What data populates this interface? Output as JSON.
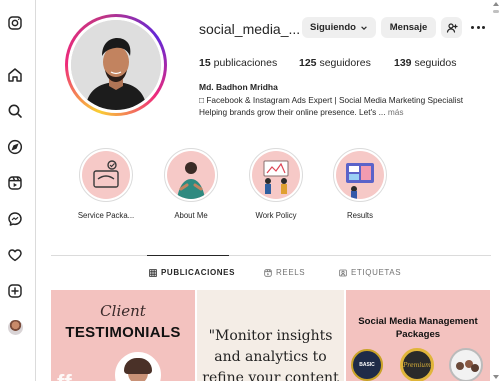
{
  "profile": {
    "username": "social_media_...",
    "following_label": "Siguiendo",
    "message_label": "Mensaje",
    "stats": {
      "posts_count": "15",
      "posts_label": "publicaciones",
      "followers_count": "125",
      "followers_label": "seguidores",
      "following_count": "139",
      "following_label": "seguidos"
    },
    "full_name": "Md. Badhon Mridha",
    "bio_line1": "□ Facebook & Instagram Ads Expert | Social Media Marketing Specialist",
    "bio_line2": "Helping brands grow their online presence. Let's ...",
    "bio_more": "más"
  },
  "highlights": [
    {
      "label": "Service Packa..."
    },
    {
      "label": "About Me"
    },
    {
      "label": "Work Policy"
    },
    {
      "label": "Results"
    }
  ],
  "tabs": [
    {
      "label": "PUBLICACIONES",
      "icon": "grid-icon",
      "active": true
    },
    {
      "label": "REELS",
      "icon": "reels-icon",
      "active": false
    },
    {
      "label": "ETIQUETAS",
      "icon": "tagged-icon",
      "active": false
    }
  ],
  "posts": {
    "post1": {
      "line1": "Client",
      "line2": "TESTIMONIALS"
    },
    "post2": {
      "line1": "\"Monitor insights",
      "line2": "and analytics to",
      "line3": "refine your content"
    },
    "post3": {
      "line1": "Social Media Management",
      "line2": "Packages",
      "badge1": "BASIC",
      "badge2": "Premium"
    }
  },
  "colors": {
    "post_pink": "#f3c2bf",
    "post_cream": "#f4ede6",
    "highlight_bg": "#f6c9c7"
  }
}
